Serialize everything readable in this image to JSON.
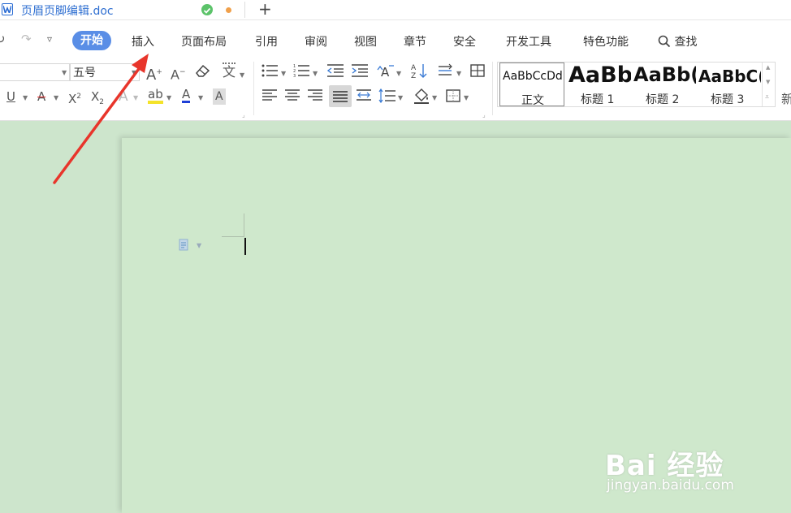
{
  "window": {
    "doc_title": "页眉页脚编辑.doc",
    "new_tab_symbol": "+",
    "doc_icon": "word-doc-icon",
    "saved_icon": "check-circle-icon",
    "unsaved_icon": "dot-icon"
  },
  "ribbon": {
    "quick_access": [
      "redo-icon",
      "customize-icon"
    ],
    "tabs": [
      {
        "label": "开始",
        "active": true
      },
      {
        "label": "插入",
        "active": false
      },
      {
        "label": "页面布局",
        "active": false
      },
      {
        "label": "引用",
        "active": false
      },
      {
        "label": "审阅",
        "active": false
      },
      {
        "label": "视图",
        "active": false
      },
      {
        "label": "章节",
        "active": false
      },
      {
        "label": "安全",
        "active": false
      },
      {
        "label": "开发工具",
        "active": false
      },
      {
        "label": "特色功能",
        "active": false
      }
    ],
    "search_label": "查找",
    "accent_color": "#5a8ee6"
  },
  "toolbar": {
    "font_name_value": "",
    "font_size_value": "五号",
    "grow_font": "A",
    "shrink_font": "A",
    "pinyin_guide": "文",
    "underline": "U",
    "strikethrough": "A",
    "superscript": "X",
    "superscript_mark": "2",
    "subscript": "X",
    "subscript_mark": "2",
    "text_effect": "A",
    "highlight": "ab",
    "font_color": "A",
    "char_shading": "A",
    "sort": "A"
  },
  "styles": {
    "items": [
      {
        "sample": "AaBbCcDd",
        "name": "正文",
        "selected": true
      },
      {
        "sample": "AaBb",
        "name": "标题 1"
      },
      {
        "sample": "AaBb(",
        "name": "标题 2"
      },
      {
        "sample": "AaBbC(",
        "name": "标题 3"
      }
    ],
    "overflow_label": "新"
  },
  "watermark": {
    "brand": "Bai 经验",
    "url": "jingyan.baidu.com"
  },
  "colors": {
    "workspace_bg": "#cde5cc",
    "page_bg": "#cfe8cc",
    "arrow": "#e8352b"
  }
}
